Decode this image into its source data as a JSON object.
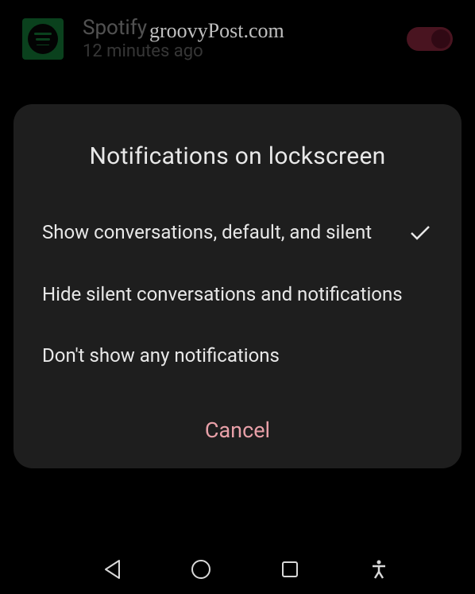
{
  "background": {
    "app_name": "Spotify",
    "timestamp": "12 minutes ago",
    "toggle_on": true
  },
  "watermark": "groovyPost.com",
  "dialog": {
    "title": "Notifications on lockscreen",
    "options": [
      {
        "label": "Show conversations, default, and silent",
        "selected": true
      },
      {
        "label": "Hide silent conversations and notifications",
        "selected": false
      },
      {
        "label": "Don't show any notifications",
        "selected": false
      }
    ],
    "cancel_label": "Cancel"
  }
}
